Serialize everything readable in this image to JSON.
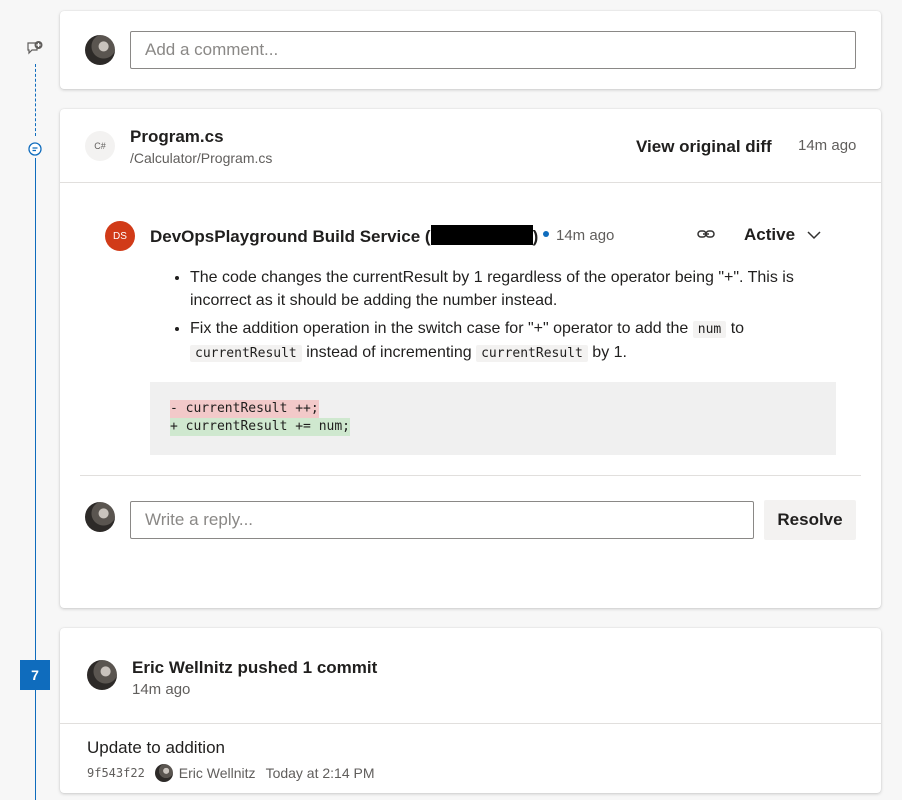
{
  "comment_box": {
    "placeholder": "Add a comment..."
  },
  "thread": {
    "file_icon_text": "C#",
    "file_name": "Program.cs",
    "file_path": "/Calculator/Program.cs",
    "view_diff_label": "View original diff",
    "time": "14m ago",
    "comment": {
      "avatar_initials": "DS",
      "author_prefix": "DevOpsPlayground Build Service (",
      "author_suffix": ")",
      "time": "14m ago",
      "status": "Active",
      "bullet1": "The code changes the currentResult by 1 regardless of the operator being \"+\". This is incorrect as it should be adding the number instead.",
      "bullet2_part1": "Fix the addition operation in the switch case for \"+\" operator to add the",
      "bullet2_code1": "num",
      "bullet2_part2": "to",
      "bullet2_code2": "currentResult",
      "bullet2_part3": "instead of incrementing",
      "bullet2_code3": "currentResult",
      "bullet2_part4": "by 1.",
      "code_removed": "- currentResult ++;",
      "code_added": "+ currentResult += num;"
    },
    "reply_placeholder": "Write a reply...",
    "resolve_label": "Resolve"
  },
  "timeline": {
    "step_number": "7"
  },
  "commit_card": {
    "title": "Eric Wellnitz pushed 1 commit",
    "time": "14m ago",
    "message": "Update to addition",
    "hash": "9f543f22",
    "author": "Eric Wellnitz",
    "when": "Today at 2:14 PM"
  },
  "colors": {
    "accent": "#0f6cbd",
    "service_avatar": "#d13b18"
  }
}
